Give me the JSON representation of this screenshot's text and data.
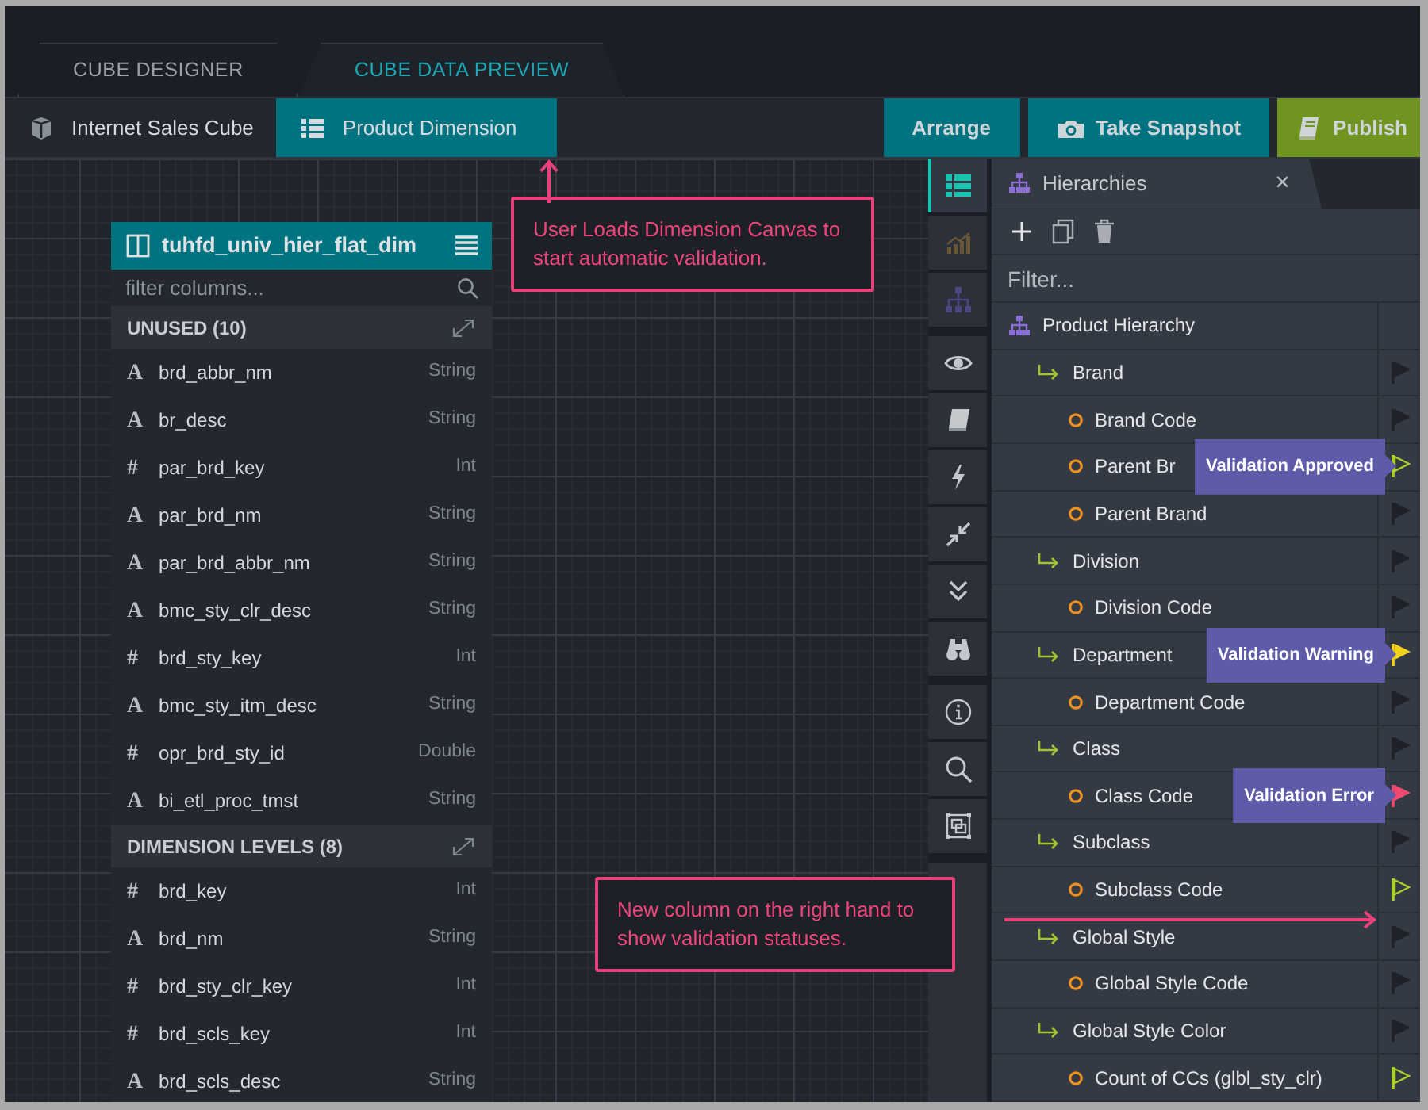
{
  "app_tabs": [
    {
      "label": "CUBE DESIGNER",
      "selected": false
    },
    {
      "label": "CUBE DATA PREVIEW",
      "selected": true
    }
  ],
  "doc_tabs": [
    {
      "label": "Internet Sales Cube",
      "kind": "cube",
      "selected": false
    },
    {
      "label": "Product Dimension",
      "kind": "dimension",
      "selected": true
    }
  ],
  "actions": [
    {
      "label": "Arrange",
      "kind": "plain"
    },
    {
      "label": "Take Snapshot",
      "kind": "snapshot"
    },
    {
      "label": "Publish",
      "kind": "publish"
    }
  ],
  "dimension_table": {
    "title": "tuhfd_univ_hier_flat_dim",
    "filter_placeholder": "filter columns...",
    "sections": [
      {
        "title": "UNUSED (10)",
        "columns": [
          {
            "type_icon": "A",
            "name": "brd_abbr_nm",
            "type": "String"
          },
          {
            "type_icon": "A",
            "name": "br_desc",
            "type": "String"
          },
          {
            "type_icon": "#",
            "name": "par_brd_key",
            "type": "Int"
          },
          {
            "type_icon": "A",
            "name": "par_brd_nm",
            "type": "String"
          },
          {
            "type_icon": "A",
            "name": "par_brd_abbr_nm",
            "type": "String"
          },
          {
            "type_icon": "A",
            "name": "bmc_sty_clr_desc",
            "type": "String"
          },
          {
            "type_icon": "#",
            "name": "brd_sty_key",
            "type": "Int"
          },
          {
            "type_icon": "A",
            "name": "bmc_sty_itm_desc",
            "type": "String"
          },
          {
            "type_icon": "#",
            "name": "opr_brd_sty_id",
            "type": "Double"
          },
          {
            "type_icon": "A",
            "name": "bi_etl_proc_tmst",
            "type": "String"
          }
        ]
      },
      {
        "title": "DIMENSION LEVELS (8)",
        "columns": [
          {
            "type_icon": "#",
            "name": "brd_key",
            "type": "Int"
          },
          {
            "type_icon": "A",
            "name": "brd_nm",
            "type": "String"
          },
          {
            "type_icon": "#",
            "name": "brd_sty_clr_key",
            "type": "Int"
          },
          {
            "type_icon": "#",
            "name": "brd_scls_key",
            "type": "Int"
          },
          {
            "type_icon": "A",
            "name": "brd_scls_desc",
            "type": "String"
          }
        ]
      }
    ]
  },
  "tool_groups": [
    [
      {
        "kind": "table",
        "selected": true
      },
      {
        "kind": "chart",
        "selected": false
      },
      {
        "kind": "hierarchy",
        "selected": false
      }
    ],
    [
      {
        "kind": "eye",
        "selected": false
      },
      {
        "kind": "book",
        "selected": false
      },
      {
        "kind": "bolt",
        "selected": false
      },
      {
        "kind": "compress",
        "selected": false
      },
      {
        "kind": "chevrons",
        "selected": false
      },
      {
        "kind": "binoculars",
        "selected": false
      }
    ],
    [
      {
        "kind": "info",
        "selected": false
      },
      {
        "kind": "search",
        "selected": false
      },
      {
        "kind": "frame",
        "selected": false
      }
    ]
  ],
  "hierarchy_panel": {
    "title": "Hierarchies",
    "close": "×",
    "filter_placeholder": "Filter...",
    "hierarchies": [
      {
        "name": "Product Hierarchy",
        "children": [
          {
            "name": "Brand",
            "color": "#1e2228",
            "outlined": false,
            "children": [
              {
                "name": "Brand Code",
                "color": "#1e2228",
                "outlined": false
              },
              {
                "name": "Parent Br",
                "color": "#a8d12c",
                "outlined": true,
                "tooltip": "Validation Approved"
              },
              {
                "name": "Parent Brand",
                "color": "#1e2228",
                "outlined": false
              }
            ]
          },
          {
            "name": "Division",
            "color": "#1e2228",
            "outlined": false,
            "children": [
              {
                "name": "Division Code",
                "color": "#1e2228",
                "outlined": false
              }
            ]
          },
          {
            "name": "Department",
            "color": "#f2d21a",
            "outlined": false,
            "tooltip": "Validation Warning",
            "children": [
              {
                "name": "Department Code",
                "color": "#1e2228",
                "outlined": false
              }
            ]
          },
          {
            "name": "Class",
            "color": "#1e2228",
            "outlined": false,
            "children": [
              {
                "name": "Class Code",
                "color": "#f04a73",
                "outlined": false,
                "tooltip": "Validation Error"
              }
            ]
          },
          {
            "name": "Subclass",
            "color": "#1e2228",
            "outlined": false,
            "children": [
              {
                "name": "Subclass Code",
                "color": "#a8d12c",
                "outlined": true
              }
            ]
          },
          {
            "name": "Global Style",
            "color": "#1e2228",
            "outlined": false,
            "children": [
              {
                "name": "Global Style Code",
                "color": "#1e2228",
                "outlined": false
              }
            ]
          },
          {
            "name": "Global Style Color",
            "color": "#1e2228",
            "outlined": false,
            "children": [
              {
                "name": "Count of CCs (glbl_sty_clr)",
                "color": "#a8d12c",
                "outlined": true
              }
            ]
          }
        ]
      }
    ]
  },
  "callouts": [
    {
      "text": "User Loads Dimension Canvas to start automatic validation.",
      "kind": "up"
    },
    {
      "text": "New column on the right hand to show validation statuses.",
      "kind": "right"
    }
  ]
}
